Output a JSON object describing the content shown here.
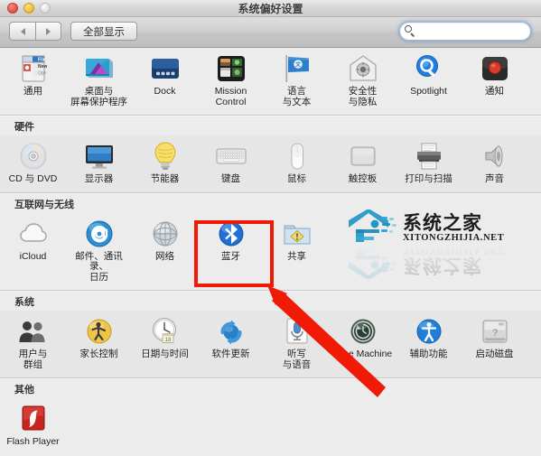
{
  "window": {
    "title": "系统偏好设置",
    "controls": {
      "close": "close-button",
      "minimize": "minimize-button",
      "zoom": "zoom-button"
    }
  },
  "toolbar": {
    "back_label": "◀",
    "forward_label": "▶",
    "show_all_label": "全部显示",
    "search": {
      "value": "",
      "placeholder": ""
    }
  },
  "sections": [
    {
      "id": "personal",
      "header": "",
      "items": [
        {
          "label": "通用",
          "icon": "general-icon"
        },
        {
          "label": "桌面与\n屏幕保护程序",
          "icon": "desktop-screensaver-icon"
        },
        {
          "label": "Dock",
          "icon": "dock-icon"
        },
        {
          "label": "Mission\nControl",
          "icon": "mission-control-icon"
        },
        {
          "label": "语言\n与文本",
          "icon": "language-text-icon"
        },
        {
          "label": "安全性\n与隐私",
          "icon": "security-privacy-icon"
        },
        {
          "label": "Spotlight",
          "icon": "spotlight-icon"
        },
        {
          "label": "通知",
          "icon": "notifications-icon"
        }
      ]
    },
    {
      "id": "hardware",
      "header": "硬件",
      "items": [
        {
          "label": "CD 与 DVD",
          "icon": "cd-dvd-icon"
        },
        {
          "label": "显示器",
          "icon": "displays-icon"
        },
        {
          "label": "节能器",
          "icon": "energy-saver-icon"
        },
        {
          "label": "键盘",
          "icon": "keyboard-icon"
        },
        {
          "label": "鼠标",
          "icon": "mouse-icon"
        },
        {
          "label": "触控板",
          "icon": "trackpad-icon"
        },
        {
          "label": "打印与扫描",
          "icon": "print-scan-icon"
        },
        {
          "label": "声音",
          "icon": "sound-icon"
        }
      ]
    },
    {
      "id": "internet",
      "header": "互联网与无线",
      "items": [
        {
          "label": "iCloud",
          "icon": "icloud-icon"
        },
        {
          "label": "邮件、通讯录、\n日历",
          "icon": "mail-contacts-calendars-icon"
        },
        {
          "label": "网络",
          "icon": "network-icon"
        },
        {
          "label": "蓝牙",
          "icon": "bluetooth-icon"
        },
        {
          "label": "共享",
          "icon": "sharing-icon"
        }
      ]
    },
    {
      "id": "system",
      "header": "系统",
      "items": [
        {
          "label": "用户与\n群组",
          "icon": "users-groups-icon"
        },
        {
          "label": "家长控制",
          "icon": "parental-controls-icon"
        },
        {
          "label": "日期与时间",
          "icon": "date-time-icon"
        },
        {
          "label": "软件更新",
          "icon": "software-update-icon"
        },
        {
          "label": "听写\n与语音",
          "icon": "dictation-speech-icon"
        },
        {
          "label": "Time Machine",
          "icon": "time-machine-icon"
        },
        {
          "label": "辅助功能",
          "icon": "accessibility-icon"
        },
        {
          "label": "启动磁盘",
          "icon": "startup-disk-icon"
        }
      ]
    },
    {
      "id": "other",
      "header": "其他",
      "items": [
        {
          "label": "Flash Player",
          "icon": "flash-player-icon"
        }
      ]
    }
  ],
  "annotation": {
    "highlight_target": "蓝牙",
    "color": "#f01a07"
  },
  "watermark": {
    "cn": "系统之家",
    "en": "XITONGZHIJIA.NET",
    "color": "#2196c4"
  }
}
